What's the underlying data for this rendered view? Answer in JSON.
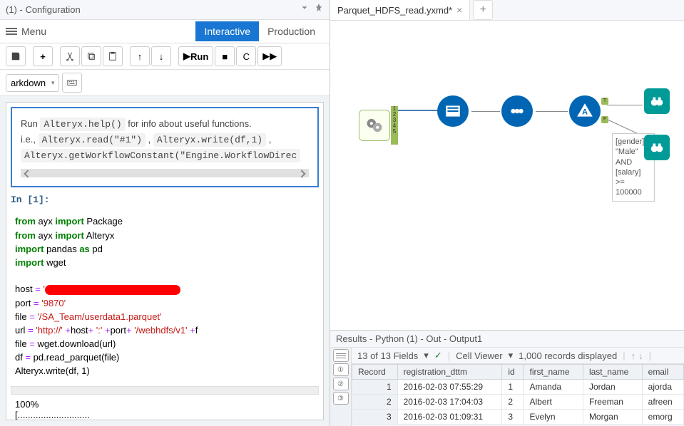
{
  "leftPanel": {
    "title": "(1) - Configuration",
    "menuLabel": "Menu",
    "modes": {
      "interactive": "Interactive",
      "production": "Production"
    },
    "runLabel": "Run",
    "celltype": "arkdown",
    "helpLine1a": "Run ",
    "helpCode1": "Alteryx.help()",
    "helpLine1b": " for info about useful functions.",
    "helpLine2a": "i.e., ",
    "helpCode2": "Alteryx.read(\"#1\")",
    "helpComma": " , ",
    "helpCode3": "Alteryx.write(df,1)",
    "helpCode4": "Alteryx.getWorkflowConstant(\"Engine.WorkflowDirec",
    "prompt": "In [1]:",
    "code": {
      "l1": [
        "from",
        " ayx ",
        "import",
        " Package"
      ],
      "l2": [
        "from",
        " ayx ",
        "import",
        " Alteryx"
      ],
      "l3": [
        "import",
        " pandas ",
        "as",
        " pd"
      ],
      "l4": [
        "import",
        " wget"
      ],
      "l5": [
        "host ",
        "=",
        " '"
      ],
      "l6": [
        "port ",
        "=",
        " ",
        "'9870'"
      ],
      "l7": [
        "file ",
        "=",
        " ",
        "'/SA_Team/userdata1.parquet'"
      ],
      "l8": [
        "url ",
        "=",
        " ",
        "'http://'",
        " ",
        "+",
        "host",
        "+",
        " ",
        "':'",
        " ",
        "+",
        "port",
        "+",
        " ",
        "'/webhdfs/v1'",
        " ",
        "+",
        "f"
      ],
      "l9": [
        "file ",
        "=",
        " wget.download(url)"
      ],
      "l10": [
        "df ",
        "=",
        " pd.read_parquet(file)"
      ],
      "l11": [
        "Alteryx.write(df, ",
        "1",
        ")"
      ]
    },
    "output1": "100%",
    "output2": "[............................"
  },
  "rightPanel": {
    "tabName": "Parquet_HDFS_read.yxmd*",
    "filterExpr": [
      "[gender] =",
      "\"Male\"",
      "AND",
      "[salary] >=",
      "100000"
    ]
  },
  "results": {
    "title": "Results - Python (1) - Out - Output1",
    "fields": "13 of 13 Fields",
    "cellviewer": "Cell Viewer",
    "records": "1,000 records displayed",
    "columns": [
      "Record",
      "registration_dttm",
      "id",
      "first_name",
      "last_name",
      "email"
    ],
    "rows": [
      [
        "1",
        "2016-02-03 07:55:29",
        "1",
        "Amanda",
        "Jordan",
        "ajorda"
      ],
      [
        "2",
        "2016-02-03 17:04:03",
        "2",
        "Albert",
        "Freeman",
        "afreen"
      ],
      [
        "3",
        "2016-02-03 01:09:31",
        "3",
        "Evelyn",
        "Morgan",
        "emorg"
      ]
    ]
  }
}
